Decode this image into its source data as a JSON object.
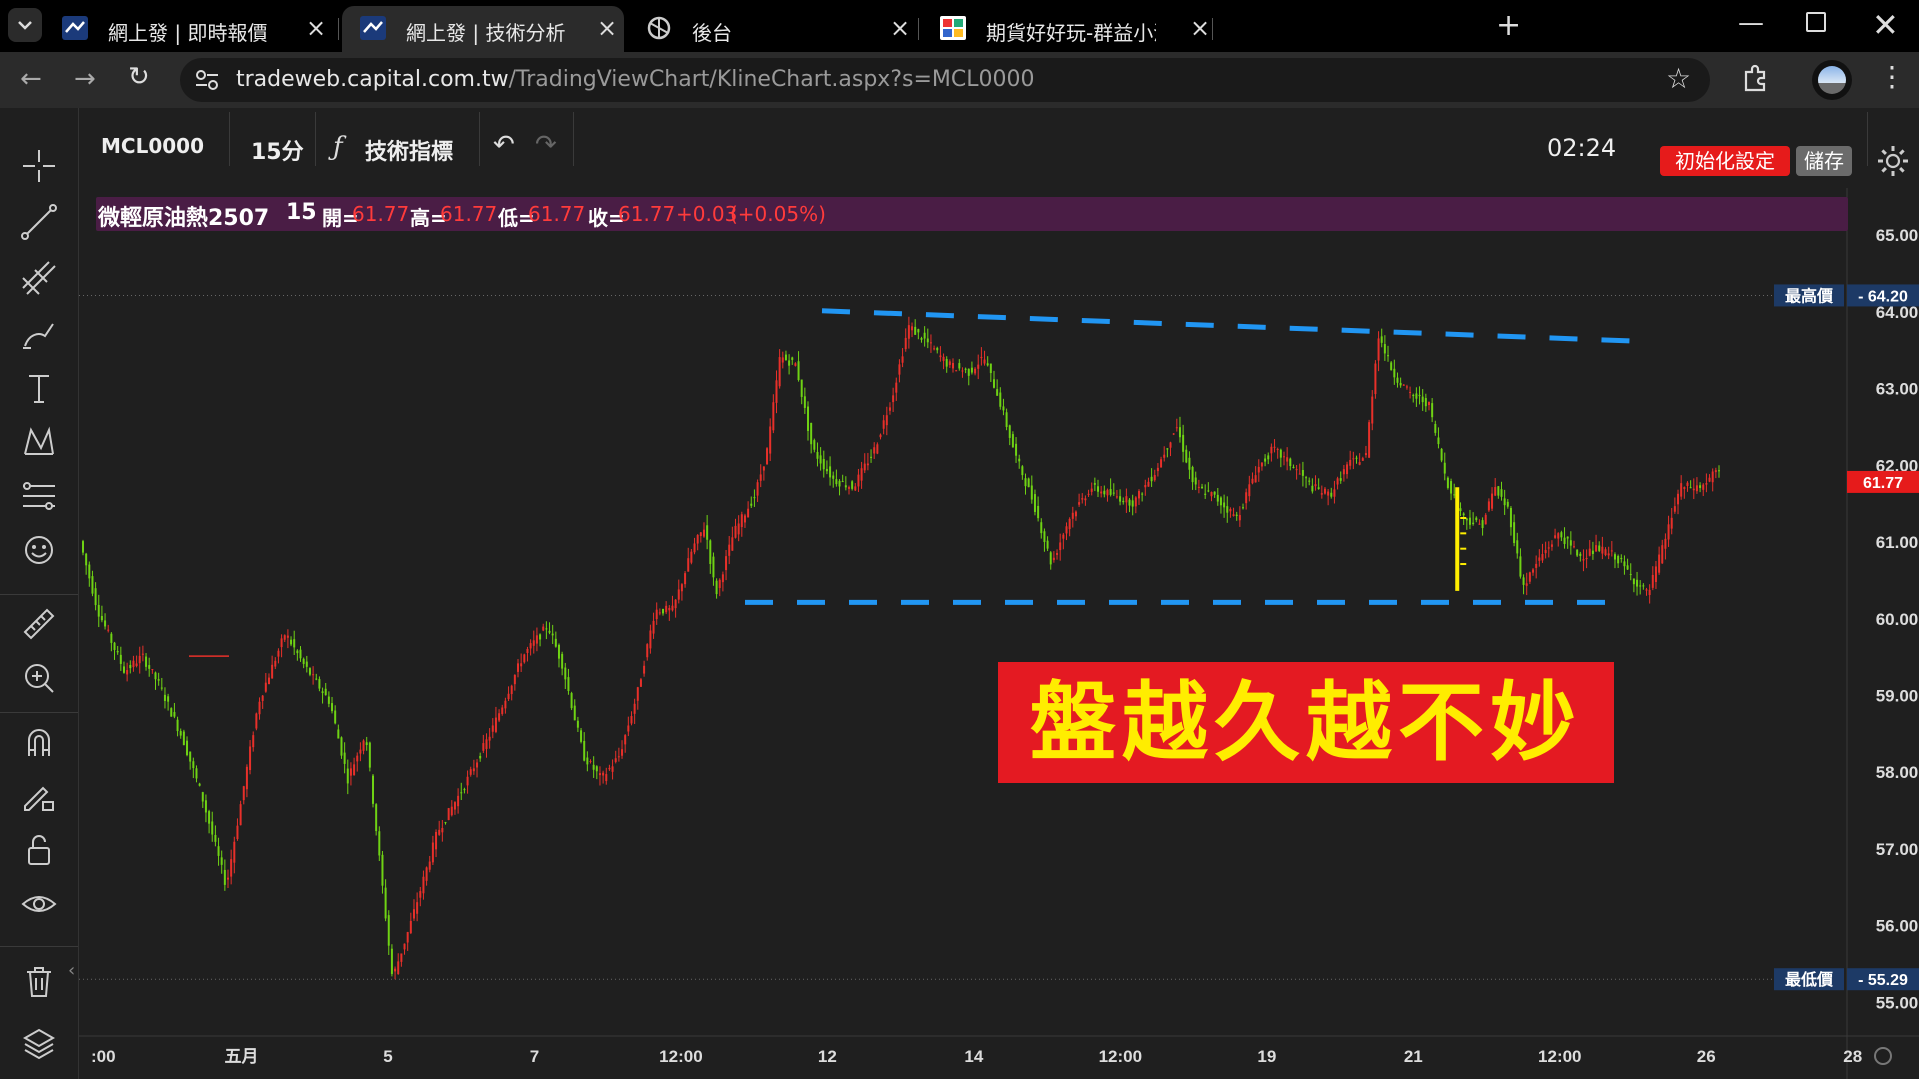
{
  "tabs": [
    {
      "title": "網上發 | 即時報價",
      "active": false
    },
    {
      "title": "網上發 | 技術分析",
      "active": true
    },
    {
      "title": "後台",
      "active": false
    },
    {
      "title": "期貨好好玩-群益小涵團隊|唯一",
      "active": false
    }
  ],
  "address": {
    "domain": "tradeweb.capital.com.tw",
    "path": "/TradingViewChart/KlineChart.aspx?s=MCL0000"
  },
  "toolbar": {
    "symbol": "MCL0000",
    "interval": "15分",
    "indicators_label": "技術指標",
    "clock": "02:24",
    "init_label": "初始化設定",
    "save_label": "儲存"
  },
  "legend": {
    "name": "微輕原油熱2507",
    "interval": "15",
    "open_label": "開=",
    "open": "61.77",
    "high_label": "高=",
    "high": "61.77",
    "low_label": "低=",
    "low": "61.77",
    "close_label": "收=",
    "close": "61.77",
    "change": "+0.03",
    "change_pct": "(+0.05%)"
  },
  "banner": {
    "text": "盤越久越不妙"
  },
  "chart_data": {
    "type": "candlestick",
    "y_ticks": [
      "65.00",
      "64.00",
      "63.00",
      "62.00",
      "61.00",
      "60.00",
      "59.00",
      "58.00",
      "57.00",
      "56.00",
      "55.00"
    ],
    "ylim": [
      54.55,
      65.6
    ],
    "x_ticks": [
      ":00",
      "五月",
      "5",
      "7",
      "12:00",
      "12",
      "14",
      "12:00",
      "19",
      "21",
      "12:00",
      "26",
      "28"
    ],
    "max_label": "最高價",
    "max_value": "64.20",
    "min_label": "最低價",
    "min_value": "55.29",
    "last_value": "61.77",
    "path_points": [
      [
        0,
        61.0
      ],
      [
        10,
        60.1
      ],
      [
        25,
        59.3
      ],
      [
        35,
        59.5
      ],
      [
        45,
        59.1
      ],
      [
        58,
        58.4
      ],
      [
        68,
        57.7
      ],
      [
        82,
        56.5
      ],
      [
        100,
        58.9
      ],
      [
        115,
        59.8
      ],
      [
        125,
        59.4
      ],
      [
        140,
        58.9
      ],
      [
        150,
        57.9
      ],
      [
        160,
        58.5
      ],
      [
        175,
        55.3
      ],
      [
        185,
        56.0
      ],
      [
        200,
        57.2
      ],
      [
        215,
        57.8
      ],
      [
        230,
        58.5
      ],
      [
        248,
        59.5
      ],
      [
        262,
        59.9
      ],
      [
        270,
        59.4
      ],
      [
        282,
        58.2
      ],
      [
        292,
        57.9
      ],
      [
        302,
        58.2
      ],
      [
        312,
        59.0
      ],
      [
        322,
        60.1
      ],
      [
        332,
        60.1
      ],
      [
        343,
        60.9
      ],
      [
        350,
        61.2
      ],
      [
        356,
        60.3
      ],
      [
        366,
        61.1
      ],
      [
        378,
        61.6
      ],
      [
        385,
        62.2
      ],
      [
        392,
        63.4
      ],
      [
        401,
        63.3
      ],
      [
        410,
        62.2
      ],
      [
        422,
        61.8
      ],
      [
        433,
        61.7
      ],
      [
        445,
        62.2
      ],
      [
        455,
        62.9
      ],
      [
        464,
        63.8
      ],
      [
        474,
        63.6
      ],
      [
        486,
        63.3
      ],
      [
        498,
        63.2
      ],
      [
        506,
        63.4
      ],
      [
        514,
        62.9
      ],
      [
        524,
        62.1
      ],
      [
        534,
        61.5
      ],
      [
        544,
        60.7
      ],
      [
        554,
        61.3
      ],
      [
        566,
        61.7
      ],
      [
        578,
        61.6
      ],
      [
        590,
        61.5
      ],
      [
        602,
        61.9
      ],
      [
        614,
        62.5
      ],
      [
        624,
        61.7
      ],
      [
        634,
        61.6
      ],
      [
        648,
        61.3
      ],
      [
        658,
        61.9
      ],
      [
        668,
        62.2
      ],
      [
        678,
        62.0
      ],
      [
        690,
        61.7
      ],
      [
        700,
        61.6
      ],
      [
        710,
        62.0
      ],
      [
        720,
        62.1
      ],
      [
        727,
        63.7
      ],
      [
        735,
        63.2
      ],
      [
        745,
        62.9
      ],
      [
        755,
        62.8
      ],
      [
        765,
        61.8
      ],
      [
        775,
        61.3
      ],
      [
        785,
        61.2
      ],
      [
        792,
        61.7
      ],
      [
        800,
        61.4
      ],
      [
        808,
        60.4
      ],
      [
        818,
        60.8
      ],
      [
        828,
        61.1
      ],
      [
        840,
        60.8
      ],
      [
        850,
        60.9
      ],
      [
        860,
        60.8
      ],
      [
        870,
        60.5
      ],
      [
        878,
        60.3
      ],
      [
        886,
        60.9
      ],
      [
        896,
        61.7
      ],
      [
        908,
        61.7
      ],
      [
        916,
        61.9
      ]
    ],
    "resistance_line": [
      [
        0,
        64.0
      ],
      [
        1,
        63.6
      ]
    ],
    "support_line": [
      [
        0,
        60.2
      ],
      [
        1,
        60.2
      ]
    ]
  }
}
